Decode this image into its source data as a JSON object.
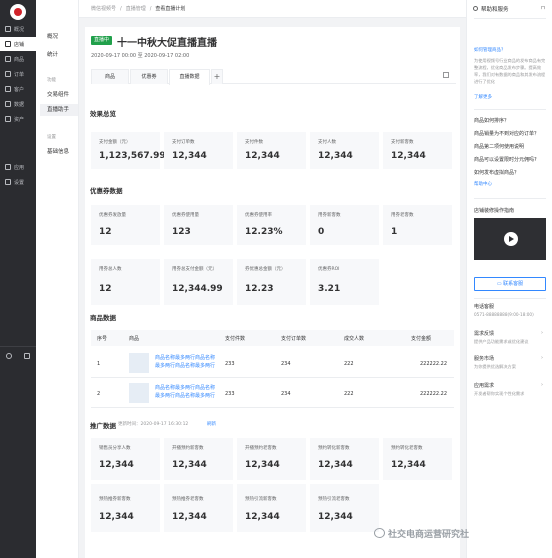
{
  "sidebar": {
    "items": [
      {
        "label": "概况"
      },
      {
        "label": "店铺"
      },
      {
        "label": "商品"
      },
      {
        "label": "订单"
      },
      {
        "label": "客户"
      },
      {
        "label": "数据"
      },
      {
        "label": "资产"
      },
      {
        "label": "应用"
      },
      {
        "label": "设置"
      }
    ]
  },
  "submenu": {
    "items": [
      "概况",
      "统计"
    ],
    "group_label": "功能",
    "func_items": [
      "交易组件",
      "直播助手"
    ],
    "group2_label": "设置",
    "settings_items": [
      "基础信息"
    ]
  },
  "breadcrumb": {
    "items": [
      "微信视频号",
      "直播管理",
      "查看直播计划"
    ]
  },
  "live": {
    "badge": "直播中",
    "title": "十一中秋大促直播直播",
    "time": "2020-09-17 00:00 至 2020-09-17 02:00"
  },
  "tabs": [
    "商品",
    "优惠券",
    "直播数据"
  ],
  "tab_add": "+",
  "effect": {
    "title": "效果总览",
    "stats": [
      {
        "label": "支付金额（元）",
        "value": "1,123,567.99"
      },
      {
        "label": "支付订单数",
        "value": "12,344"
      },
      {
        "label": "支付件数",
        "value": "12,344"
      },
      {
        "label": "支付人数",
        "value": "12,344"
      },
      {
        "label": "支付新客数",
        "value": "12,344"
      }
    ]
  },
  "coupon": {
    "title": "优惠券数据",
    "stats": [
      {
        "label": "优惠券发放量",
        "value": "12"
      },
      {
        "label": "优惠券使用量",
        "value": "123"
      },
      {
        "label": "优惠券使用率",
        "value": "12.23%"
      },
      {
        "label": "用券新客数",
        "value": "0"
      },
      {
        "label": "用券老客数",
        "value": "1"
      },
      {
        "label": "用券总人数",
        "value": "12"
      },
      {
        "label": "用券总支付金额（元）",
        "value": "12,344.99"
      },
      {
        "label": "券优惠总金额（元）",
        "value": "12.23"
      },
      {
        "label": "优惠券ROI",
        "value": "3.21"
      }
    ]
  },
  "products": {
    "title": "商品数据",
    "headers": [
      "序号",
      "商品",
      "支付件数",
      "支付订单数",
      "成交人数",
      "支付金额"
    ],
    "rows": [
      {
        "index": "1",
        "name": "商品名称最多两行商品名称最多两行商品名称最多两行",
        "qty": "233",
        "orders": "234",
        "buyers": "222",
        "amount": "222222.22"
      },
      {
        "index": "2",
        "name": "商品名称最多两行商品名称最多两行商品名称最多两行",
        "qty": "233",
        "orders": "234",
        "buyers": "222",
        "amount": "222222.22"
      }
    ]
  },
  "promo": {
    "title": "推广数据",
    "update_label": "更新时间：2020-09-17 16:30:12",
    "refresh": "刷新",
    "stats": [
      {
        "label": "销售员分享人数",
        "value": "12,344"
      },
      {
        "label": "开播预约新客数",
        "value": "12,344"
      },
      {
        "label": "开播预约老客数",
        "value": "12,344"
      },
      {
        "label": "预约转化新客数",
        "value": "12,344"
      },
      {
        "label": "预约转化老客数",
        "value": "12,344"
      },
      {
        "label": "预热推券新客数",
        "value": "12,344"
      },
      {
        "label": "预热推券老客数",
        "value": "12,344"
      },
      {
        "label": "预热引流新客数",
        "value": "12,344"
      },
      {
        "label": "预热引流老客数",
        "value": "12,344"
      }
    ]
  },
  "right_panel": {
    "title": "帮助和服务",
    "q1": "如何管理商品？",
    "q1_desc": "为使用视频号行业商品的发布商品有完整流程，优化商品发布步骤。提高效率，我们对有数据的商品和其发布流程进行了优化",
    "learn_more": "了解更多",
    "faqs": [
      "商品如何排序？",
      "商品销量为不到对应的订单？",
      "商品第二项何使用说明",
      "商品可以设置限时分元佣吗?",
      "如何发布虚拟商品？"
    ],
    "help_center": "帮助中心",
    "video_title": "店铺装修操作指南",
    "contact": "联系客服",
    "phone_label": "电话客服",
    "phone": "0571-88888888(9:00-18:00)",
    "links": [
      {
        "title": "需求反馈",
        "desc": "提供产品功能需求或优化建议"
      },
      {
        "title": "服务市场",
        "desc": "为你提供优选解决方案"
      },
      {
        "title": "应用需求",
        "desc": "开发者帮你实现个性化需求"
      }
    ]
  },
  "watermark": "社交电商运营研究社"
}
